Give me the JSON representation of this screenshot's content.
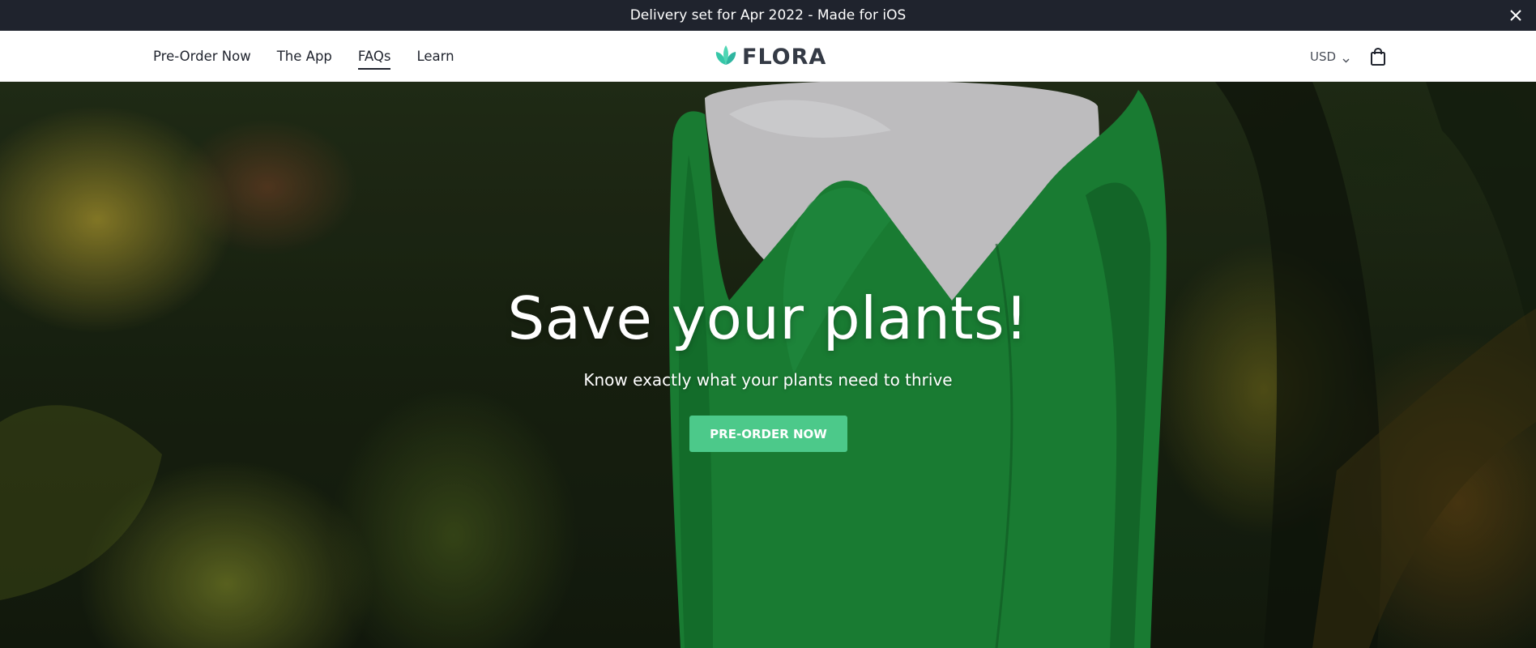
{
  "announcement": {
    "text": "Delivery set for Apr 2022 - Made for iOS",
    "close_icon": "close-icon"
  },
  "header": {
    "nav": [
      {
        "label": "Pre-Order Now"
      },
      {
        "label": "The App"
      },
      {
        "label": "FAQs",
        "active": true
      },
      {
        "label": "Learn"
      }
    ],
    "logo": {
      "text": "FLORA",
      "icon": "leaf-logo-icon"
    },
    "currency": {
      "label": "USD",
      "icon": "chevron-down-icon"
    },
    "cart_icon": "shopping-bag-icon"
  },
  "hero": {
    "title": "Save your plants!",
    "subtitle": "Know exactly what your plants need to thrive",
    "cta_label": "PRE-ORDER NOW"
  },
  "colors": {
    "announcement_bg": "#1f232d",
    "accent": "#4cc98a",
    "logo_leaf": "#3fc7a0",
    "text_dark": "#1f232d"
  }
}
